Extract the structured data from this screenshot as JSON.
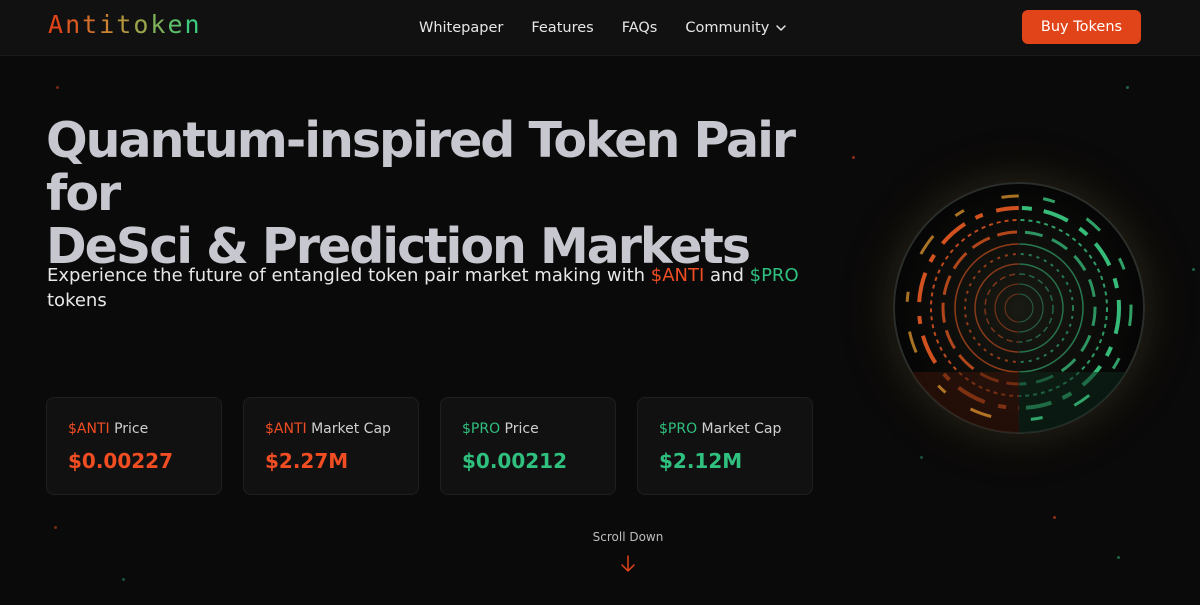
{
  "nav": {
    "logo": [
      "A",
      "n",
      "t",
      "i",
      "t",
      "o",
      "k",
      "e",
      "n"
    ],
    "logo_colors": [
      "#e2441a",
      "#dc5a22",
      "#d06e2a",
      "#c98332",
      "#b3953d",
      "#9aa24a",
      "#7eb05a",
      "#5ec06c",
      "#3dcb7d"
    ],
    "links": [
      "Whitepaper",
      "Features",
      "FAQs"
    ],
    "community_label": "Community",
    "buy_button": "Buy Tokens"
  },
  "hero": {
    "title_line1": "Quantum-inspired Token Pair for",
    "title_line2": "DeSci & Prediction Markets",
    "subtitle_prefix": "Experience the future of entangled token pair market making with ",
    "anti_token": "$ANTI",
    "subtitle_and": " and ",
    "pro_token": "$PRO",
    "subtitle_suffix": " tokens"
  },
  "stats": [
    {
      "token": "$ANTI",
      "label": " Price",
      "value": "$0.00227",
      "kind": "anti"
    },
    {
      "token": "$ANTI",
      "label": " Market Cap",
      "value": "$2.27M",
      "kind": "anti"
    },
    {
      "token": "$PRO",
      "label": " Price",
      "value": "$0.00212",
      "kind": "pro"
    },
    {
      "token": "$PRO",
      "label": " Market Cap",
      "value": "$2.12M",
      "kind": "pro"
    }
  ],
  "scroll": {
    "label": "Scroll Down"
  },
  "colors": {
    "accent_anti": "#f04d22",
    "accent_pro": "#2fc07f",
    "button": "#e2441a",
    "background": "#0a0a0a"
  },
  "icons": {
    "community_dropdown": "chevron-down-icon",
    "scroll": "arrow-down-icon",
    "hero_visual": "quantum-orb-graphic"
  }
}
